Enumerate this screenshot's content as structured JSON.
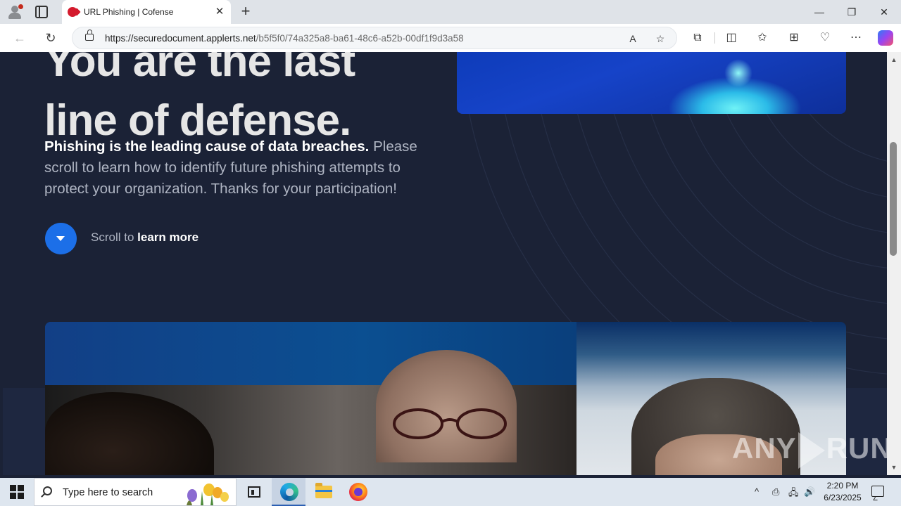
{
  "browser": {
    "tab_title": "URL Phishing | Cofense",
    "tab_close_glyph": "✕",
    "new_tab_glyph": "+",
    "window_controls": {
      "minimize": "—",
      "restore": "❐",
      "close": "✕"
    },
    "url_host": "https://securedocument.applerts.net",
    "url_path": "/b5f5f0/74a325a8-ba61-48c6-a52b-00df1f9d3a58",
    "nav": {
      "back": "←",
      "reload": "↻"
    },
    "icons": [
      "read-aloud-icon",
      "favorite-star-icon",
      "extensions-icon",
      "split-screen-icon",
      "favorites-icon",
      "collections-icon",
      "browser-essentials-icon",
      "more-icon",
      "copilot-icon"
    ]
  },
  "page": {
    "hero_title_line1": "You are the last",
    "hero_title_line2": "line of defense.",
    "lede_bold": "Phishing is the leading cause of data breaches.",
    "lede_rest": " Please scroll to learn how to identify future phishing attempts to protect your organization. Thanks for your participation!",
    "scroll_prefix": "Scroll to ",
    "scroll_bold": "learn more",
    "accent_color": "#1c6fe8",
    "background_color": "#1b2236"
  },
  "watermark": {
    "left": "ANY",
    "right": "RUN"
  },
  "taskbar": {
    "search_placeholder": "Type here to search",
    "time": "2:20 PM",
    "date": "6/23/2025",
    "apps": [
      "task-view-icon",
      "edge-icon",
      "file-explorer-icon",
      "firefox-icon"
    ],
    "tray": {
      "chevron": "^",
      "speaker": "🔊"
    }
  }
}
